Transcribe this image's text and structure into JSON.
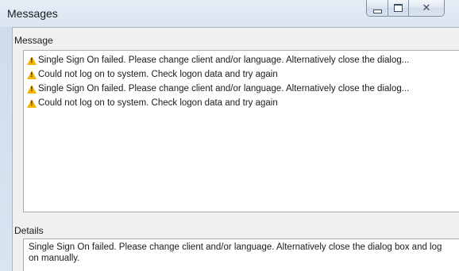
{
  "window": {
    "title": "Messages"
  },
  "caption_buttons": {
    "minimize_icon": "minimize-icon",
    "maximize_icon": "maximize-icon",
    "close_icon": "close-icon",
    "close_glyph": "✕"
  },
  "messages": {
    "label": "Message",
    "items": [
      {
        "icon": "warning-icon",
        "text": "Single Sign On failed. Please change client and/or language. Alternatively close the dialog..."
      },
      {
        "icon": "warning-icon",
        "text": "Could not log on to system. Check logon data and try again"
      },
      {
        "icon": "warning-icon",
        "text": "Single Sign On failed. Please change client and/or language. Alternatively close the dialog..."
      },
      {
        "icon": "warning-icon",
        "text": "Could not log on to system. Check logon data and try again"
      }
    ]
  },
  "details": {
    "label": "Details",
    "text": "Single Sign On failed. Please change client and/or language. Alternatively close the dialog box and log on manually."
  },
  "colors": {
    "warning": "#f1b400",
    "window_frame": "#d7e4f1",
    "client_background": "#f0f0f0"
  }
}
